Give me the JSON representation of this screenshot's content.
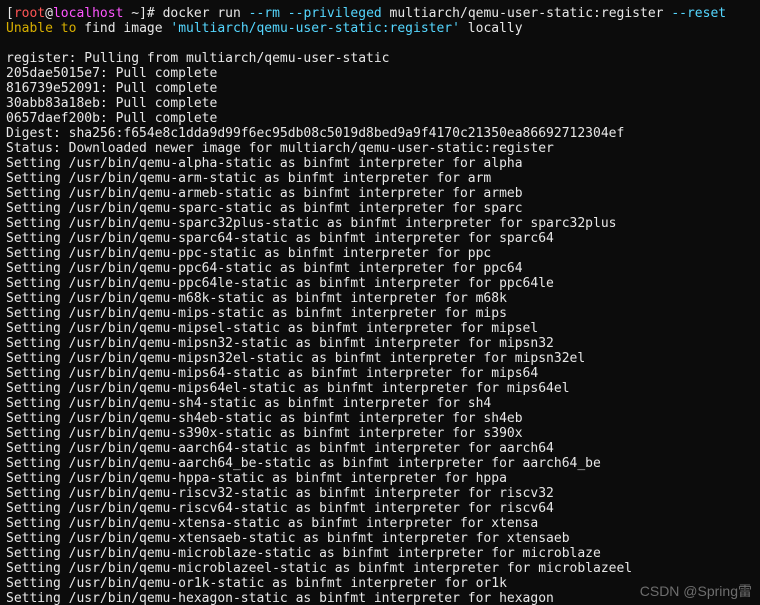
{
  "prompt": {
    "open": "[",
    "user": "root",
    "at": "@",
    "host": "localhost",
    "path": " ~",
    "close": "]",
    "hash": "# "
  },
  "cmd": {
    "docker_run": "docker run ",
    "opt_rm": "--rm ",
    "opt_priv": "--privileged ",
    "image": "multiarch/qemu-user-static:register ",
    "opt_reset": "--reset"
  },
  "unable": {
    "p1": "Unable ",
    "p2": "to ",
    "p3": "find image ",
    "p4": "'multiarch/qemu-user-static:register'",
    "p5": " locally"
  },
  "pull_header": "register: Pulling from multiarch/qemu-user-static",
  "layers": [
    "205dae5015e7: Pull complete",
    "816739e52091: Pull complete",
    "30abb83a18eb: Pull complete",
    "0657daef200b: Pull complete"
  ],
  "digest": "Digest: sha256:f654e8c1dda9d99f6ec95db08c5019d8bed9a9f4170c21350ea86692712304ef",
  "status": "Status: Downloaded newer image for multiarch/qemu-user-static:register",
  "settings": [
    "Setting /usr/bin/qemu-alpha-static as binfmt interpreter for alpha",
    "Setting /usr/bin/qemu-arm-static as binfmt interpreter for arm",
    "Setting /usr/bin/qemu-armeb-static as binfmt interpreter for armeb",
    "Setting /usr/bin/qemu-sparc-static as binfmt interpreter for sparc",
    "Setting /usr/bin/qemu-sparc32plus-static as binfmt interpreter for sparc32plus",
    "Setting /usr/bin/qemu-sparc64-static as binfmt interpreter for sparc64",
    "Setting /usr/bin/qemu-ppc-static as binfmt interpreter for ppc",
    "Setting /usr/bin/qemu-ppc64-static as binfmt interpreter for ppc64",
    "Setting /usr/bin/qemu-ppc64le-static as binfmt interpreter for ppc64le",
    "Setting /usr/bin/qemu-m68k-static as binfmt interpreter for m68k",
    "Setting /usr/bin/qemu-mips-static as binfmt interpreter for mips",
    "Setting /usr/bin/qemu-mipsel-static as binfmt interpreter for mipsel",
    "Setting /usr/bin/qemu-mipsn32-static as binfmt interpreter for mipsn32",
    "Setting /usr/bin/qemu-mipsn32el-static as binfmt interpreter for mipsn32el",
    "Setting /usr/bin/qemu-mips64-static as binfmt interpreter for mips64",
    "Setting /usr/bin/qemu-mips64el-static as binfmt interpreter for mips64el",
    "Setting /usr/bin/qemu-sh4-static as binfmt interpreter for sh4",
    "Setting /usr/bin/qemu-sh4eb-static as binfmt interpreter for sh4eb",
    "Setting /usr/bin/qemu-s390x-static as binfmt interpreter for s390x",
    "Setting /usr/bin/qemu-aarch64-static as binfmt interpreter for aarch64",
    "Setting /usr/bin/qemu-aarch64_be-static as binfmt interpreter for aarch64_be",
    "Setting /usr/bin/qemu-hppa-static as binfmt interpreter for hppa",
    "Setting /usr/bin/qemu-riscv32-static as binfmt interpreter for riscv32",
    "Setting /usr/bin/qemu-riscv64-static as binfmt interpreter for riscv64",
    "Setting /usr/bin/qemu-xtensa-static as binfmt interpreter for xtensa",
    "Setting /usr/bin/qemu-xtensaeb-static as binfmt interpreter for xtensaeb",
    "Setting /usr/bin/qemu-microblaze-static as binfmt interpreter for microblaze",
    "Setting /usr/bin/qemu-microblazeel-static as binfmt interpreter for microblazeel",
    "Setting /usr/bin/qemu-or1k-static as binfmt interpreter for or1k",
    "Setting /usr/bin/qemu-hexagon-static as binfmt interpreter for hexagon"
  ],
  "watermark": "CSDN @Spring雷"
}
